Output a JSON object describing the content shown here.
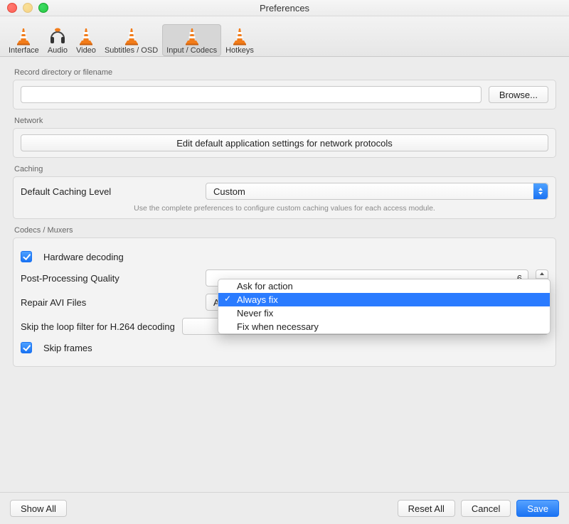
{
  "window": {
    "title": "Preferences"
  },
  "tabs": {
    "interface": "Interface",
    "audio": "Audio",
    "video": "Video",
    "subtitles": "Subtitles / OSD",
    "input_codecs": "Input / Codecs",
    "hotkeys": "Hotkeys"
  },
  "sections": {
    "record": {
      "label": "Record directory or filename",
      "path": "",
      "browse": "Browse..."
    },
    "network": {
      "label": "Network",
      "button": "Edit default application settings for network protocols"
    },
    "caching": {
      "label": "Caching",
      "level_label": "Default Caching Level",
      "level_value": "Custom",
      "helper": "Use the complete preferences to configure custom caching values for each access module."
    },
    "codecs": {
      "label": "Codecs / Muxers",
      "hardware_decoding": "Hardware decoding",
      "post_processing_label": "Post-Processing Quality",
      "post_processing_value": "6",
      "repair_avi_label": "Repair AVI Files",
      "repair_avi_selected": "Always fix",
      "repair_avi_options": [
        "Ask for action",
        "Always fix",
        "Never fix",
        "Fix when necessary"
      ],
      "skip_loop_label": "Skip the loop filter for H.264 decoding",
      "skip_frames": "Skip frames"
    }
  },
  "footer": {
    "show_all": "Show All",
    "reset_all": "Reset All",
    "cancel": "Cancel",
    "save": "Save"
  }
}
